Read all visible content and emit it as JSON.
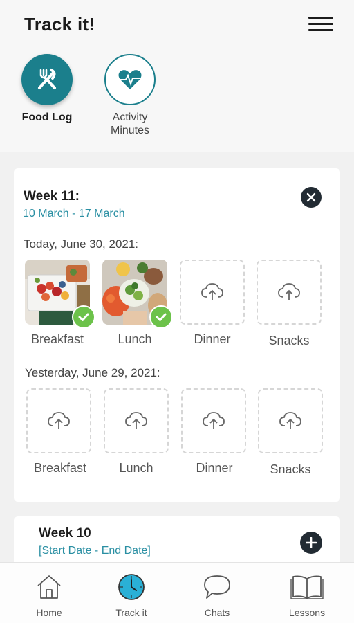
{
  "header": {
    "title": "Track it!",
    "menu_icon": "hamburger-menu-icon"
  },
  "trackers": [
    {
      "label": "Food Log",
      "icon": "fork-knife-icon",
      "active": true
    },
    {
      "label": "Activity\nMinutes",
      "icon": "heart-pulse-icon",
      "active": false
    }
  ],
  "week11": {
    "title": "Week 11:",
    "dates": "10 March - 17 March",
    "today_label": "Today, June 30, 2021:",
    "today_slots": [
      "Breakfast",
      "Lunch",
      "Dinner",
      "Snacks"
    ],
    "yesterday_label": "Yesterday, June 29, 2021:",
    "yesterday_slots": [
      "Breakfast",
      "Lunch",
      "Dinner",
      "Snacks"
    ]
  },
  "week10": {
    "title": "Week 10",
    "dates": "[Start Date - End Date]"
  },
  "nav": [
    {
      "label": "Home",
      "icon": "home-icon"
    },
    {
      "label": "Track it",
      "icon": "clock-icon"
    },
    {
      "label": "Chats",
      "icon": "chat-bubble-icon"
    },
    {
      "label": "Lessons",
      "icon": "book-icon"
    }
  ],
  "colors": {
    "accent": "#1b7f8c",
    "link": "#2a8fa3",
    "check": "#6cc24a",
    "dark_button": "#222b33"
  }
}
